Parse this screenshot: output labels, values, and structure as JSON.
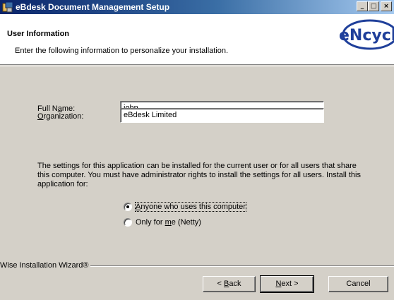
{
  "window": {
    "title": "eBdesk Document Management Setup",
    "controls": [
      "minimize",
      "maximize",
      "close"
    ]
  },
  "header": {
    "title": "User Information",
    "subtitle": "Enter the following information to personalize your installation.",
    "logo_text": "eNcyclo"
  },
  "form": {
    "full_name": {
      "label_pre": "Full N",
      "label_mnemonic": "a",
      "label_post": "me:",
      "value": "john"
    },
    "organization": {
      "label_pre": "",
      "label_mnemonic": "O",
      "label_post": "rganization:",
      "value": "eBdesk Limited"
    }
  },
  "install_scope": {
    "description": "The settings for this application can be installed for the current user or for all users that share this computer. You must have administrator rights to install the settings for all users. Install this application for:",
    "options": [
      {
        "label_pre": "",
        "label_mnemonic": "A",
        "label_post": "nyone who uses this computer",
        "selected": true
      },
      {
        "label_pre": "Only for ",
        "label_mnemonic": "m",
        "label_post": "e (Netty)",
        "selected": false
      }
    ]
  },
  "footer": {
    "branding": "Wise Installation Wizard®",
    "back_pre": "< ",
    "back_mnemonic": "B",
    "back_post": "ack",
    "next_mnemonic": "N",
    "next_post": "ext >",
    "cancel_label": "Cancel"
  },
  "colors": {
    "title_bar_start": "#0a246a",
    "title_bar_end": "#a6caf0",
    "dialog_face": "#d4d0c8",
    "logo_blue": "#1f3f9a"
  }
}
